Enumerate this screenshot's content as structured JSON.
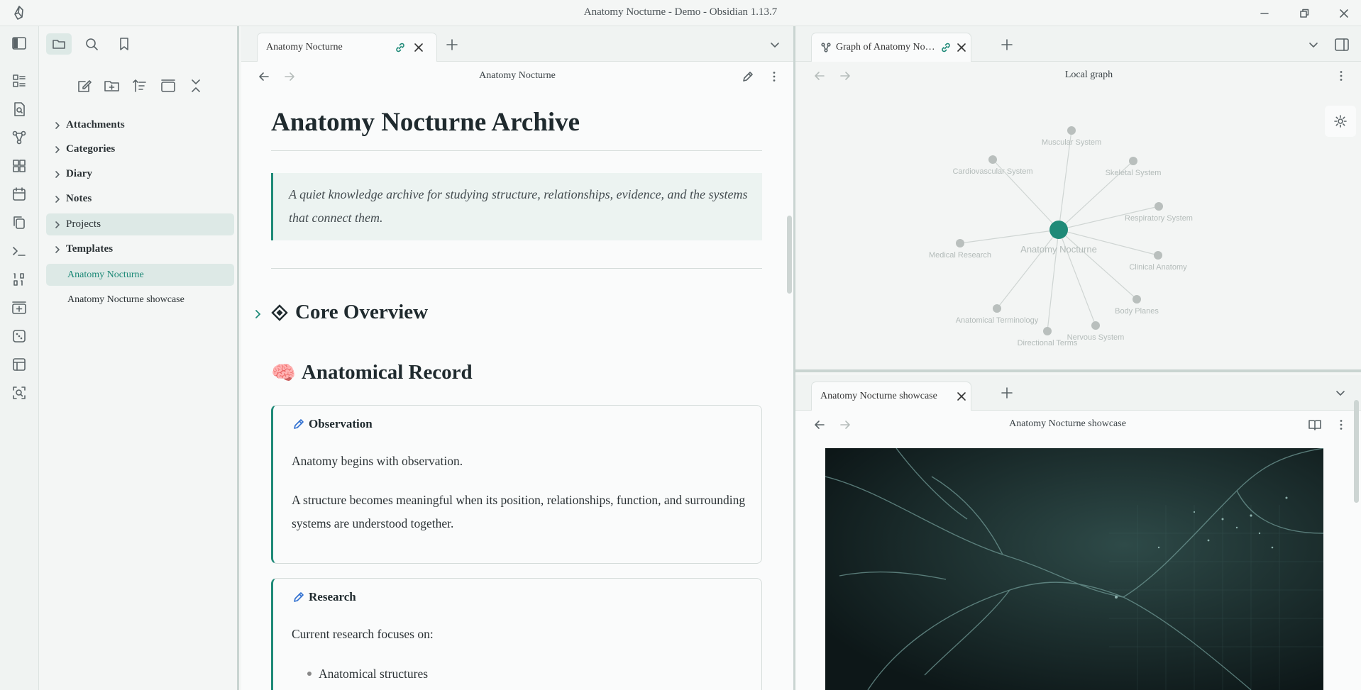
{
  "window": {
    "title": "Anatomy Nocturne - Demo - Obsidian 1.13.7"
  },
  "sidebar": {
    "tree": [
      {
        "label": "Attachments",
        "type": "folder"
      },
      {
        "label": "Categories",
        "type": "folder"
      },
      {
        "label": "Diary",
        "type": "folder"
      },
      {
        "label": "Notes",
        "type": "folder"
      },
      {
        "label": "Projects",
        "type": "folder"
      },
      {
        "label": "Templates",
        "type": "folder"
      },
      {
        "label": "Anatomy Nocturne",
        "type": "file"
      },
      {
        "label": "Anatomy Nocturne showcase",
        "type": "file"
      }
    ]
  },
  "left_pane": {
    "tab_label": "Anatomy Nocturne",
    "view_title": "Anatomy Nocturne",
    "doc": {
      "h1": "Anatomy Nocturne Archive",
      "quote": "A quiet knowledge archive for studying structure, relationships, evidence, and the systems that connect them.",
      "h2_overview": "Core Overview",
      "h2_record_emoji": "🧠",
      "h2_record": "Anatomical Record",
      "callouts": [
        {
          "title": "Observation",
          "paragraphs": [
            "Anatomy begins with observation.",
            "A structure becomes meaningful when its position, relationships, function, and surrounding systems are understood together."
          ]
        },
        {
          "title": "Research",
          "paragraphs": [
            "Current research focuses on:"
          ],
          "list": [
            "Anatomical structures"
          ]
        }
      ]
    }
  },
  "graph_pane": {
    "tab_label": "Graph of Anatomy No…",
    "view_title": "Local graph",
    "center": "Anatomy Nocturne",
    "nodes": [
      "Muscular System",
      "Cardiovascular System",
      "Skeletal System",
      "Respiratory System",
      "Medical Research",
      "Clinical Anatomy",
      "Body Planes",
      "Anatomical Terminology",
      "Nervous System",
      "Directional Terms"
    ],
    "accent": "#1f8a78"
  },
  "showcase_pane": {
    "tab_label": "Anatomy Nocturne showcase",
    "view_title": "Anatomy Nocturne showcase"
  }
}
